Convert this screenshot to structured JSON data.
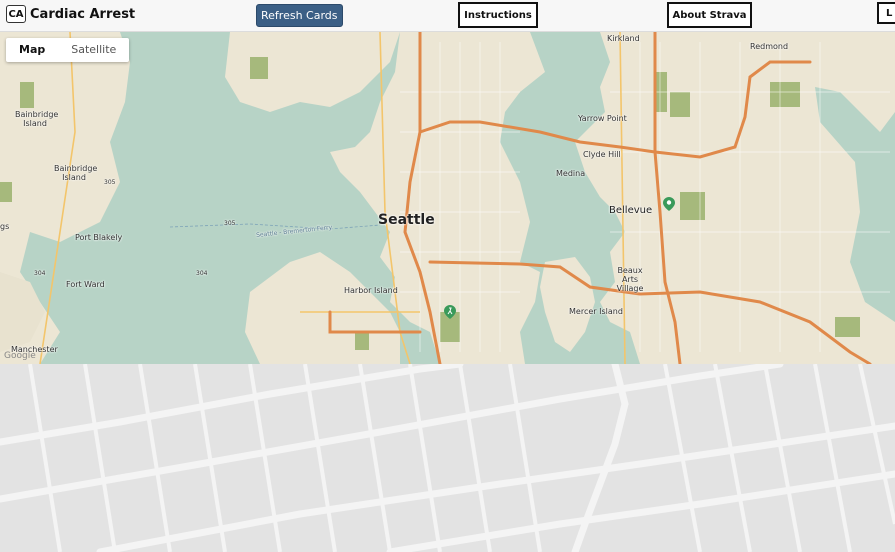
{
  "header": {
    "logo_text": "CA",
    "title": "Cardiac Arrest",
    "refresh_label": "Refresh Cards",
    "nav": [
      "Instructions",
      "About Strava",
      "L"
    ]
  },
  "map_controls": {
    "map_label": "Map",
    "satellite_label": "Satellite",
    "active": "Map"
  },
  "map": {
    "places": {
      "kirkland": "Kirkland",
      "redmond": "Redmond",
      "bainbridge_island_1": "Bainbridge Island",
      "bainbridge_island_2": "Bainbridge Island",
      "yarrow_point": "Yarrow Point",
      "clyde_hill": "Clyde Hill",
      "medina": "Medina",
      "seattle": "Seattle",
      "bellevue": "Bellevue",
      "port_blakely": "Port Blakely",
      "beaux_arts_village": "Beaux Arts Village",
      "fort_ward": "Fort Ward",
      "harbor_island": "Harbor Island",
      "mercer_island": "Mercer Island",
      "manchester": "Manchester",
      "ferry": "Seattle - Bremerton Ferry",
      "rt305": "305",
      "rt304a": "304",
      "rt304b": "304",
      "rt305b": "305",
      "partial_left": "gs"
    },
    "colors": {
      "water": "#b7d3c6",
      "land": "#ece6d4",
      "park": "#a6b97c",
      "highway": "#e0894a",
      "major_road": "#f3c56b"
    }
  }
}
